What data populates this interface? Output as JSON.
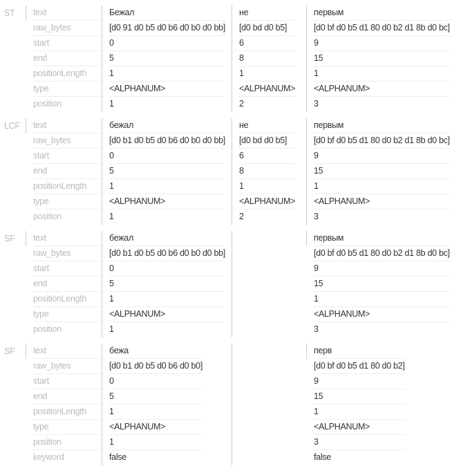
{
  "groups": [
    {
      "name": "ST",
      "labels": [
        "text",
        "raw_bytes",
        "start",
        "end",
        "positionLength",
        "type",
        "position"
      ],
      "tokens": [
        {
          "text": "Бежал",
          "raw_bytes": "[d0 91 d0 b5 d0 b6 d0 b0 d0 bb]",
          "start": "0",
          "end": "5",
          "positionLength": "1",
          "type": "<ALPHANUM>",
          "position": "1"
        },
        {
          "text": "не",
          "raw_bytes": "[d0 bd d0 b5]",
          "start": "6",
          "end": "8",
          "positionLength": "1",
          "type": "<ALPHANUM>",
          "position": "2"
        },
        {
          "text": "первым",
          "raw_bytes": "[d0 bf d0 b5 d1 80 d0 b2 d1 8b d0 bc]",
          "start": "9",
          "end": "15",
          "positionLength": "1",
          "type": "<ALPHANUM>",
          "position": "3"
        }
      ]
    },
    {
      "name": "LCF",
      "labels": [
        "text",
        "raw_bytes",
        "start",
        "end",
        "positionLength",
        "type",
        "position"
      ],
      "tokens": [
        {
          "text": "бежал",
          "raw_bytes": "[d0 b1 d0 b5 d0 b6 d0 b0 d0 bb]",
          "start": "0",
          "end": "5",
          "positionLength": "1",
          "type": "<ALPHANUM>",
          "position": "1"
        },
        {
          "text": "не",
          "raw_bytes": "[d0 bd d0 b5]",
          "start": "6",
          "end": "8",
          "positionLength": "1",
          "type": "<ALPHANUM>",
          "position": "2"
        },
        {
          "text": "первым",
          "raw_bytes": "[d0 bf d0 b5 d1 80 d0 b2 d1 8b d0 bc]",
          "start": "9",
          "end": "15",
          "positionLength": "1",
          "type": "<ALPHANUM>",
          "position": "3"
        }
      ]
    },
    {
      "name": "SF",
      "labels": [
        "text",
        "raw_bytes",
        "start",
        "end",
        "positionLength",
        "type",
        "position"
      ],
      "tokens": [
        {
          "text": "бежал",
          "raw_bytes": "[d0 b1 d0 b5 d0 b6 d0 b0 d0 bb]",
          "start": "0",
          "end": "5",
          "positionLength": "1",
          "type": "<ALPHANUM>",
          "position": "1"
        },
        null,
        {
          "text": "первым",
          "raw_bytes": "[d0 bf d0 b5 d1 80 d0 b2 d1 8b d0 bc]",
          "start": "9",
          "end": "15",
          "positionLength": "1",
          "type": "<ALPHANUM>",
          "position": "3"
        }
      ]
    },
    {
      "name": "SF",
      "labels": [
        "text",
        "raw_bytes",
        "start",
        "end",
        "positionLength",
        "type",
        "position",
        "keyword"
      ],
      "tokens": [
        {
          "text": "бежа",
          "raw_bytes": "[d0 b1 d0 b5 d0 b6 d0 b0]",
          "start": "0",
          "end": "5",
          "positionLength": "1",
          "type": "<ALPHANUM>",
          "position": "1",
          "keyword": "false"
        },
        null,
        {
          "text": "перв",
          "raw_bytes": "[d0 bf d0 b5 d1 80 d0 b2]",
          "start": "9",
          "end": "15",
          "positionLength": "1",
          "type": "<ALPHANUM>",
          "position": "3",
          "keyword": "false"
        }
      ]
    }
  ]
}
